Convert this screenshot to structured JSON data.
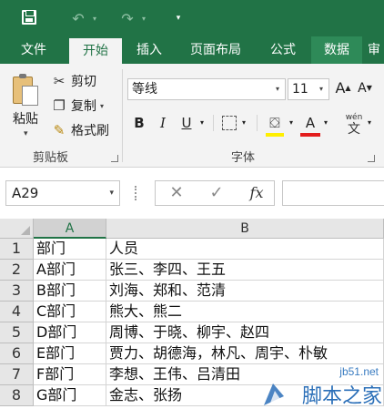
{
  "quick_access": {
    "save": "save-icon",
    "undo": "undo-icon",
    "redo": "redo-icon",
    "customize": "customize-caret-icon"
  },
  "tabs": [
    {
      "label": "文件"
    },
    {
      "label": "开始"
    },
    {
      "label": "插入"
    },
    {
      "label": "页面布局"
    },
    {
      "label": "公式"
    },
    {
      "label": "数据"
    },
    {
      "label": "审"
    }
  ],
  "ribbon": {
    "clipboard": {
      "paste_label": "粘贴",
      "cut_label": "剪切",
      "copy_label": "复制",
      "format_painter_label": "格式刷",
      "group_label": "剪贴板"
    },
    "font": {
      "font_name": "等线",
      "font_size": "11",
      "bold": "B",
      "italic": "I",
      "underline": "U",
      "increase_size": "A",
      "decrease_size": "A",
      "font_color": "A",
      "phonetic": "wén",
      "phonetic_char": "文",
      "group_label": "字体"
    }
  },
  "formula_bar": {
    "name_box": "A29",
    "cancel": "✕",
    "enter": "✓",
    "fx": "fx",
    "formula": ""
  },
  "grid": {
    "columns": [
      "A",
      "B"
    ],
    "selected_column": "A",
    "rows": [
      {
        "num": "1",
        "a": "部门",
        "b": "人员"
      },
      {
        "num": "2",
        "a": "A部门",
        "b": "张三、李四、王五"
      },
      {
        "num": "3",
        "a": "B部门",
        "b": "刘海、郑和、范清"
      },
      {
        "num": "4",
        "a": "C部门",
        "b": "熊大、熊二"
      },
      {
        "num": "5",
        "a": "D部门",
        "b": "周博、于晓、柳宇、赵四"
      },
      {
        "num": "6",
        "a": "E部门",
        "b": "贾力、胡德海，林凡、周宇、朴敏"
      },
      {
        "num": "7",
        "a": "F部门",
        "b": "李想、王伟、吕清田"
      },
      {
        "num": "8",
        "a": "G部门",
        "b": "金志、张扬"
      }
    ]
  },
  "watermark": {
    "url": "jb51.net",
    "brand": "脚本之家"
  },
  "colors": {
    "accent": "#217346",
    "ribbon_bg": "#f3f3f3",
    "font_color_bar": "#e31d1d",
    "highlight_bar": "#ffef00"
  }
}
